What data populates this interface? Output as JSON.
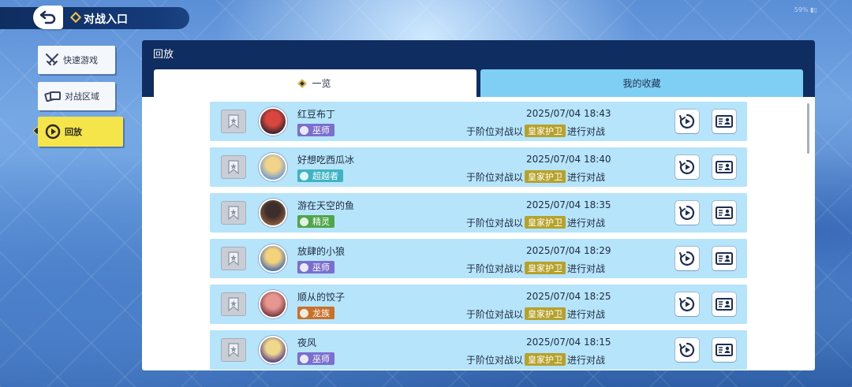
{
  "header": {
    "title": "对战入口"
  },
  "corner_text": "59% ▮▯",
  "sidebar": {
    "items": [
      {
        "label": "快速游戏",
        "icon": "crossed-swords-icon",
        "active": false
      },
      {
        "label": "对战区域",
        "icon": "cards-icon",
        "active": false
      },
      {
        "label": "回放",
        "icon": "replay-icon",
        "active": true
      }
    ]
  },
  "panel": {
    "title": "回放",
    "tabs": [
      {
        "label": "一览",
        "active": true
      },
      {
        "label": "我的收藏",
        "active": false
      }
    ]
  },
  "replays": [
    {
      "name": "红豆布丁",
      "class": "巫师",
      "class_color": "#7a6fcf",
      "time": "2025/07/04 18:43",
      "prefix": "于阶位对战以",
      "mode": "皇家护卫",
      "suffix": "进行对战",
      "avatar_colors": [
        "#d8463e",
        "#3a2430"
      ]
    },
    {
      "name": "好想吃西瓜冰",
      "class": "超越者",
      "class_color": "#3fb3c6",
      "time": "2025/07/04 18:40",
      "prefix": "于阶位对战以",
      "mode": "皇家护卫",
      "suffix": "进行对战",
      "avatar_colors": [
        "#f3d389",
        "#6d9bd3"
      ]
    },
    {
      "name": "游在天空的鱼",
      "class": "精灵",
      "class_color": "#4ea54a",
      "time": "2025/07/04 18:35",
      "prefix": "于阶位对战以",
      "mode": "皇家护卫",
      "suffix": "进行对战",
      "avatar_colors": [
        "#3b2e2c",
        "#8a5a3a"
      ]
    },
    {
      "name": "放肆的小狼",
      "class": "巫师",
      "class_color": "#7a6fcf",
      "time": "2025/07/04 18:29",
      "prefix": "于阶位对战以",
      "mode": "皇家护卫",
      "suffix": "进行对战",
      "avatar_colors": [
        "#f4d27a",
        "#4c6fb0"
      ]
    },
    {
      "name": "顺从的饺子",
      "class": "龙族",
      "class_color": "#c9712a",
      "time": "2025/07/04 18:25",
      "prefix": "于阶位对战以",
      "mode": "皇家护卫",
      "suffix": "进行对战",
      "avatar_colors": [
        "#e6968f",
        "#7a3a40"
      ]
    },
    {
      "name": "夜风",
      "class": "巫师",
      "class_color": "#7a6fcf",
      "time": "2025/07/04 18:15",
      "prefix": "于阶位对战以",
      "mode": "皇家护卫",
      "suffix": "进行对战",
      "avatar_colors": [
        "#f0d88a",
        "#5a3f8c"
      ]
    }
  ]
}
